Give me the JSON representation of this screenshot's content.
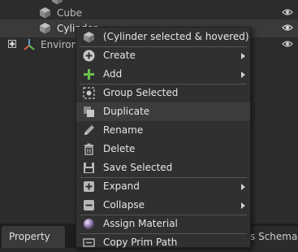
{
  "tree": {
    "rows": [
      {
        "label": "Cube"
      },
      {
        "label": "Cylinder"
      },
      {
        "label": "Environment"
      }
    ]
  },
  "menu": {
    "header": "(Cylinder selected & hovered)",
    "items": [
      {
        "label": "Create",
        "icon": "plus-circle-icon",
        "submenu": true
      },
      {
        "label": "Add",
        "icon": "green-plus-icon",
        "submenu": true
      },
      {
        "label": "Group Selected",
        "icon": "group-icon",
        "submenu": false
      },
      {
        "label": "Duplicate",
        "icon": "duplicate-icon",
        "submenu": false
      },
      {
        "label": "Rename",
        "icon": "pencil-icon",
        "submenu": false
      },
      {
        "label": "Delete",
        "icon": "trash-icon",
        "submenu": false
      },
      {
        "label": "Save Selected",
        "icon": "floppy-icon",
        "submenu": false
      },
      {
        "label": "Expand",
        "icon": "expand-icon",
        "submenu": true
      },
      {
        "label": "Collapse",
        "icon": "collapse-icon",
        "submenu": true
      },
      {
        "label": "Assign Material",
        "icon": "material-sphere-icon",
        "submenu": false
      },
      {
        "label": "Copy Prim Path",
        "icon": "copy-path-icon",
        "submenu": false
      }
    ]
  },
  "tabs": {
    "property": "Property",
    "schema": "s Schema"
  },
  "colors": {
    "green": "#6abf4b",
    "menu_bg": "#303030",
    "highlight": "#3c3c3c"
  }
}
